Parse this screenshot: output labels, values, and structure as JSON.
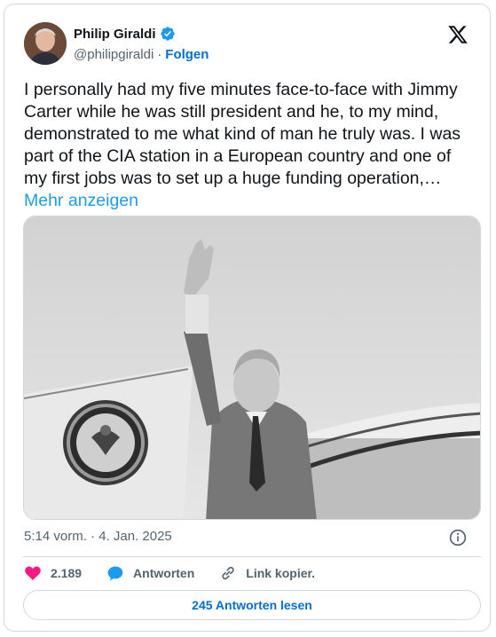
{
  "author": {
    "name": "Philip Giraldi",
    "handle": "@philipgiraldi",
    "separator": "·",
    "follow_label": "Folgen"
  },
  "tweet": {
    "text": "I personally had my five minutes face-to-face with Jimmy Carter while he was still president and he, to my mind, demonstrated to me what kind of man he truly was. I was part of the CIA station in a European country and one of my first jobs was to set up a huge funding operation,…",
    "more_label": "Mehr anzeigen",
    "timestamp": "5:14 vorm. · 4. Jan. 2025"
  },
  "actions": {
    "likes_count": "2.189",
    "reply_label": "Antworten",
    "copy_link_label": "Link kopier."
  },
  "footer": {
    "read_replies_label": "245 Antworten lesen"
  },
  "colors": {
    "accent": "#1d9bf0",
    "like": "#f91880",
    "text": "#0f1419",
    "secondary": "#536471",
    "border": "#cfd9de"
  },
  "icons": [
    "verified-badge-icon",
    "x-logo-icon",
    "info-icon",
    "heart-icon",
    "reply-bubble-icon",
    "link-icon"
  ]
}
